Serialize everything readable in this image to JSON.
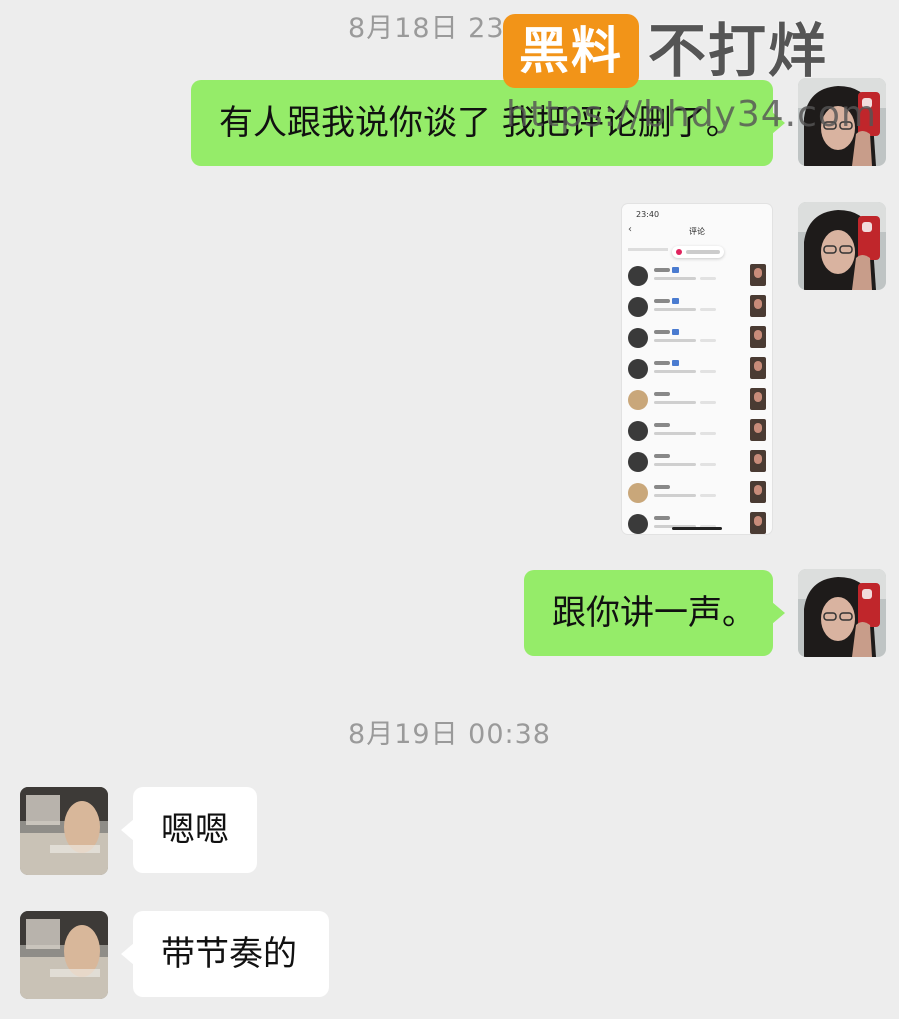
{
  "timestamps": [
    "8月18日 23:41",
    "8月19日 00:38"
  ],
  "messages": [
    {
      "direction": "outgoing",
      "type": "text",
      "text": "有人跟我说你谈了 我把评论删了。"
    },
    {
      "direction": "outgoing",
      "type": "image",
      "image_content": {
        "status_time": "23:40",
        "title": "评论"
      }
    },
    {
      "direction": "outgoing",
      "type": "text",
      "text": "跟你讲一声。"
    },
    {
      "direction": "incoming",
      "type": "text",
      "text": "嗯嗯"
    },
    {
      "direction": "incoming",
      "type": "text",
      "text": "带节奏的"
    }
  ],
  "watermark": {
    "badge": "黑料",
    "title": "不打烊",
    "url": "https://bhdy34.com"
  },
  "colors": {
    "background": "#ededed",
    "outgoing_bubble": "#95ec69",
    "incoming_bubble": "#ffffff",
    "watermark_badge": "#f29418"
  }
}
